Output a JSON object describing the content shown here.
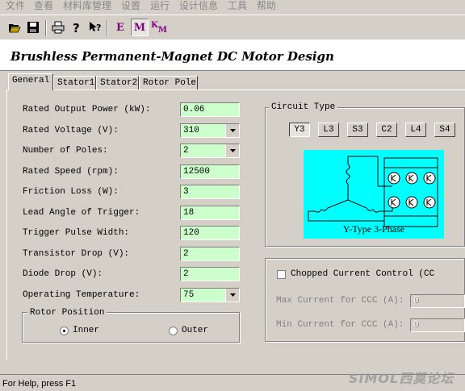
{
  "menu": [
    "文件",
    "查看",
    "材料库管理",
    "设置",
    "运行",
    "设计信息",
    "工具",
    "帮助"
  ],
  "toolbar": {
    "buttons": [
      {
        "name": "open-icon"
      },
      {
        "name": "save-icon"
      },
      {
        "name": "print-icon"
      },
      {
        "name": "help-icon"
      },
      {
        "name": "context-help-icon"
      }
    ],
    "letter_buttons": [
      {
        "label": "E"
      },
      {
        "label": "M"
      },
      {
        "label": "K",
        "sub": "M"
      }
    ]
  },
  "page_title": "Brushless Permanent-Magnet DC Motor Design",
  "tabs": [
    "General",
    "Stator1",
    "Stator2",
    "Rotor Pole"
  ],
  "fields": [
    {
      "label": "Rated Output Power (kW):",
      "value": "0.06",
      "kind": "text"
    },
    {
      "label": "Rated Voltage (V):",
      "value": "310",
      "kind": "select"
    },
    {
      "label": "Number of Poles:",
      "value": "2",
      "kind": "select"
    },
    {
      "label": "Rated Speed (rpm):",
      "value": "12500",
      "kind": "text"
    },
    {
      "label": "Friction  Loss (W):",
      "value": "3",
      "kind": "text"
    },
    {
      "label": "Lead Angle of Trigger:",
      "value": "18",
      "kind": "text"
    },
    {
      "label": "Trigger Pulse Width:",
      "value": "120",
      "kind": "text"
    },
    {
      "label": "Transistor Drop (V):",
      "value": "2",
      "kind": "text"
    },
    {
      "label": "Diode Drop (V):",
      "value": "2",
      "kind": "text"
    },
    {
      "label": "Operating Temperature:",
      "value": "75",
      "kind": "select"
    }
  ],
  "rotor_position": {
    "title": "Rotor Position",
    "options": [
      "Inner",
      "Outer"
    ],
    "selected": "Inner"
  },
  "circuit_type": {
    "title": "Circuit Type",
    "options": [
      "Y3",
      "L3",
      "S3",
      "C2",
      "L4",
      "S4"
    ],
    "selected": "Y3",
    "diagram_caption": "Y-Type 3-Phase",
    "diagram_bg": "#00ffff"
  },
  "chopped": {
    "checkbox_label": "Chopped Current Control (CC",
    "checked": false,
    "max_label": "Max Current for CCC (A):",
    "max_value": "0",
    "min_label": "Min Current for CCC (A):",
    "min_value": "0"
  },
  "status": "For Help, press F1",
  "watermark": "SIMOL西莫论坛"
}
